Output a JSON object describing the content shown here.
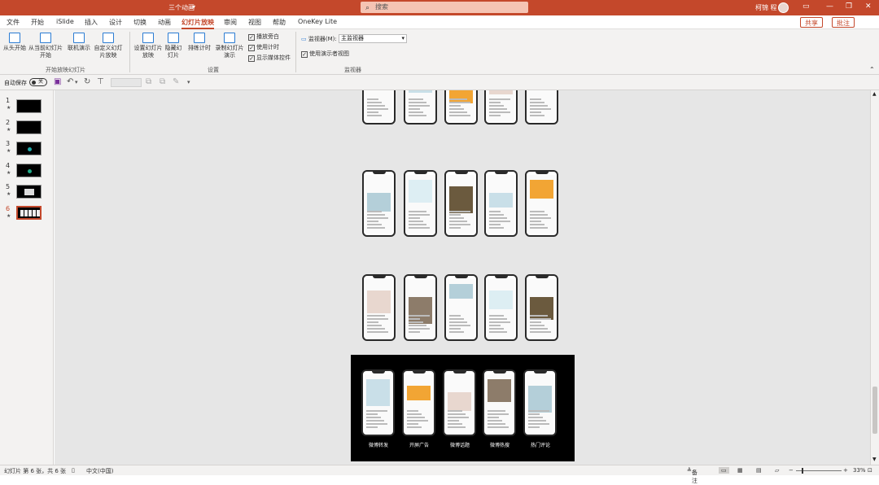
{
  "titlebar": {
    "doc_title": "三个动画",
    "search": "搜索",
    "user": "柯锦 程"
  },
  "menu": {
    "tabs": [
      "文件",
      "开始",
      "iSlide",
      "插入",
      "设计",
      "切换",
      "动画",
      "幻灯片放映",
      "审阅",
      "视图",
      "帮助",
      "OneKey Lite"
    ],
    "share": "共享",
    "comment": "批注"
  },
  "ribbon": {
    "from_start": "从头开始",
    "from_current": "从当前幻灯片开始",
    "online": "联机演示",
    "custom": "自定义幻灯片放映",
    "group1": "开始放映幻灯片",
    "setup": "设置幻灯片放映",
    "hide": "隐藏幻灯片",
    "rehearse": "排练计时",
    "record": "录制幻灯片演示",
    "chk_narration": "播放旁白",
    "chk_timings": "使用计时",
    "chk_media": "显示媒体控件",
    "group2": "设置",
    "monitor_label": "监视器(M):",
    "monitor_value": "主监视器",
    "presenter_view": "使用演示者视图",
    "group3": "监视器"
  },
  "qat": {
    "autosave": "自动保存",
    "toggle": "关"
  },
  "slides": [
    {
      "num": "1"
    },
    {
      "num": "2"
    },
    {
      "num": "3"
    },
    {
      "num": "4"
    },
    {
      "num": "5"
    },
    {
      "num": "6"
    }
  ],
  "labels": [
    "微博转发",
    "开屏广告",
    "微博话题",
    "微博热搜",
    "热门评论"
  ],
  "status": {
    "slide_info": "幻灯片 第 6 张，共 6 张",
    "lang": "中文(中国)",
    "notes": "备注",
    "zoom": "33%"
  },
  "colors": {
    "accent": "#c4482b"
  }
}
